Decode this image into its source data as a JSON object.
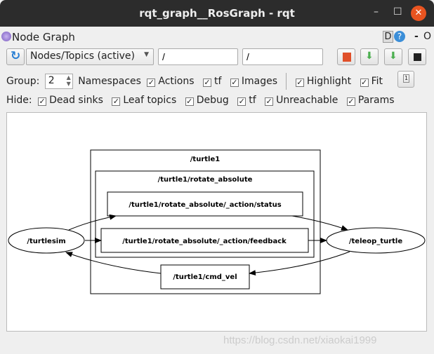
{
  "window": {
    "title": "rqt_graph__RosGraph - rqt",
    "minimize": "–",
    "maximize": "☐",
    "close": "✕"
  },
  "plugin": {
    "title": "Node Graph",
    "d_label": "D",
    "help_label": "?",
    "dash": "-",
    "o_label": "O"
  },
  "toolbar": {
    "mode": "Nodes/Topics (active)",
    "filter1": "/",
    "filter2": "/"
  },
  "options": {
    "group_label": "Group:",
    "group_value": "2",
    "namespaces": "Namespaces",
    "actions": "Actions",
    "tf": "tf",
    "images": "Images",
    "highlight": "Highlight",
    "fit": "Fit"
  },
  "hide": {
    "label": "Hide:",
    "items": [
      "Dead sinks",
      "Leaf topics",
      "Debug",
      "tf",
      "Unreachable",
      "Params"
    ]
  },
  "graph": {
    "cluster_outer": "/turtle1",
    "cluster_inner": "/turtle1/rotate_absolute",
    "status": "/turtle1/rotate_absolute/_action/status",
    "feedback": "/turtle1/rotate_absolute/_action/feedback",
    "cmd_vel": "/turtle1/cmd_vel",
    "node_left": "/turtlesim",
    "node_right": "/teleop_turtle"
  },
  "watermark": "https://blog.csdn.net/xiaokai1999",
  "colors": {
    "close": "#e95420",
    "titlebar": "#2c2c2c"
  }
}
